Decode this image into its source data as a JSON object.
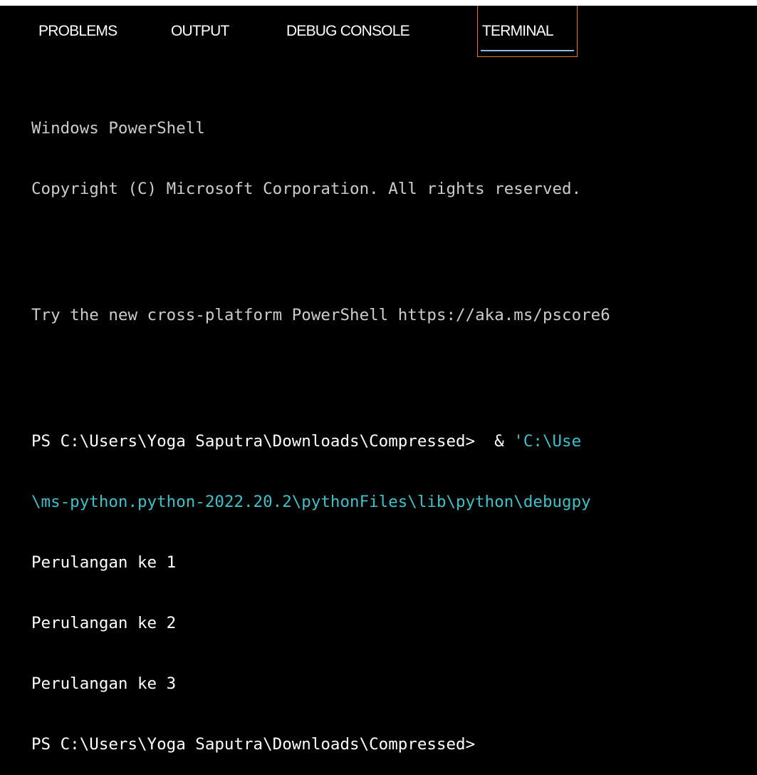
{
  "panel": {
    "tabs": [
      {
        "label": "PROBLEMS",
        "active": false
      },
      {
        "label": "OUTPUT",
        "active": false
      },
      {
        "label": "DEBUG CONSOLE",
        "active": false
      },
      {
        "label": "TERMINAL",
        "active": true
      }
    ]
  },
  "terminal": {
    "banner": [
      "Windows PowerShell",
      "Copyright (C) Microsoft Corporation. All rights reserved."
    ],
    "tip": "Try the new cross-platform PowerShell https://aka.ms/pscore6",
    "command": {
      "prompt": "PS C:\\Users\\Yoga Saputra\\Downloads\\Compressed>",
      "operator": "  & ",
      "arg_start": "'C:\\Use",
      "continuation": "\\ms-python.python-2022.20.2\\pythonFiles\\lib\\python\\debugpy"
    },
    "output": [
      "Perulangan ke 1",
      "Perulangan ke 2",
      "Perulangan ke 3"
    ],
    "final_prompt": "PS C:\\Users\\Yoga Saputra\\Downloads\\Compressed>"
  },
  "colors": {
    "background": "#000000",
    "text": "#cccccc",
    "path_highlight": "#3fc1c9",
    "active_tab_border": "#e2791d",
    "active_tab_underline": "#8fb9e0"
  }
}
